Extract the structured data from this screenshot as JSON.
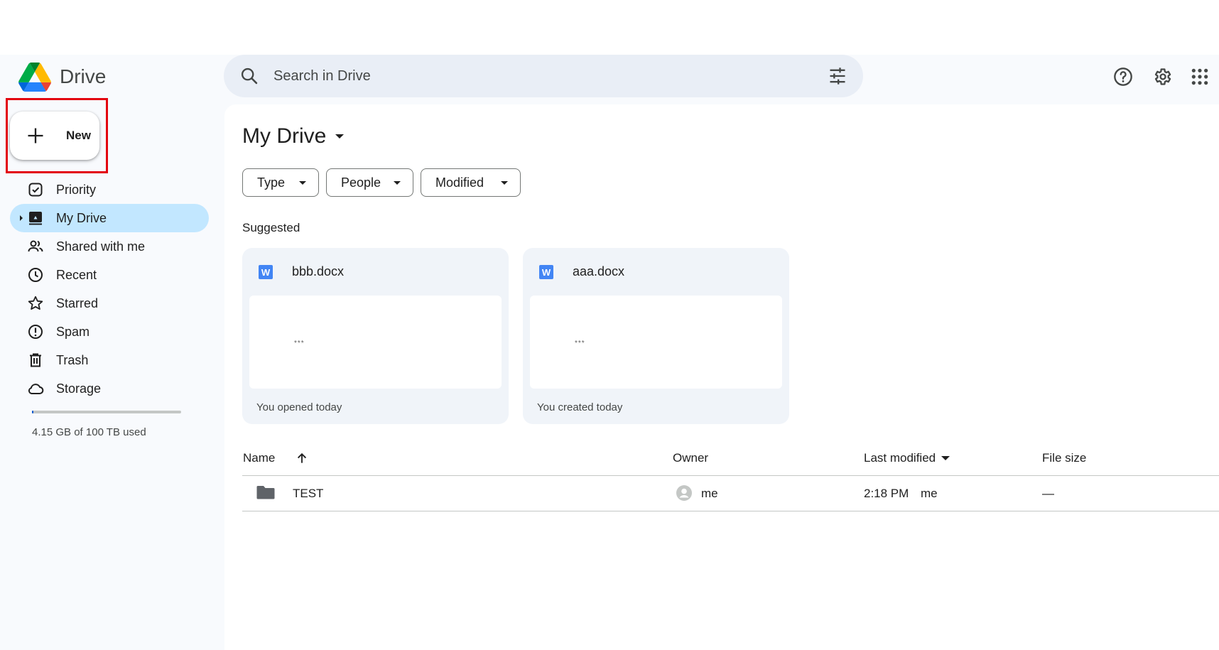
{
  "app": {
    "name": "Drive"
  },
  "search": {
    "placeholder": "Search in Drive"
  },
  "new_button": {
    "label": "New"
  },
  "sidebar": {
    "items": [
      {
        "label": "Priority",
        "icon": "priority-icon"
      },
      {
        "label": "My Drive",
        "icon": "my-drive-icon",
        "active": true
      },
      {
        "label": "Shared with me",
        "icon": "shared-icon"
      },
      {
        "label": "Recent",
        "icon": "clock-icon"
      },
      {
        "label": "Starred",
        "icon": "star-icon"
      },
      {
        "label": "Spam",
        "icon": "spam-icon"
      },
      {
        "label": "Trash",
        "icon": "trash-icon"
      },
      {
        "label": "Storage",
        "icon": "cloud-icon"
      }
    ],
    "storage": {
      "text": "4.15 GB of 100 TB used",
      "used_fraction": 0.01
    }
  },
  "main": {
    "title": "My Drive",
    "filters": [
      {
        "label": "Type"
      },
      {
        "label": "People"
      },
      {
        "label": "Modified"
      }
    ],
    "suggested_label": "Suggested",
    "suggested": [
      {
        "title": "bbb.docx",
        "subtitle": "You opened today",
        "thumb_text": "***"
      },
      {
        "title": "aaa.docx",
        "subtitle": "You created today",
        "thumb_text": "***"
      }
    ],
    "table": {
      "headers": {
        "name": "Name",
        "owner": "Owner",
        "last_modified": "Last modified",
        "file_size": "File size"
      },
      "rows": [
        {
          "name": "TEST",
          "owner": "me",
          "modified_time": "2:18 PM",
          "modified_by": "me",
          "size": "—"
        }
      ]
    }
  },
  "colors": {
    "accent": "#0b57d0",
    "active_nav": "#c2e7ff",
    "highlight_box": "#e3000f",
    "background": "#f8fafd"
  }
}
